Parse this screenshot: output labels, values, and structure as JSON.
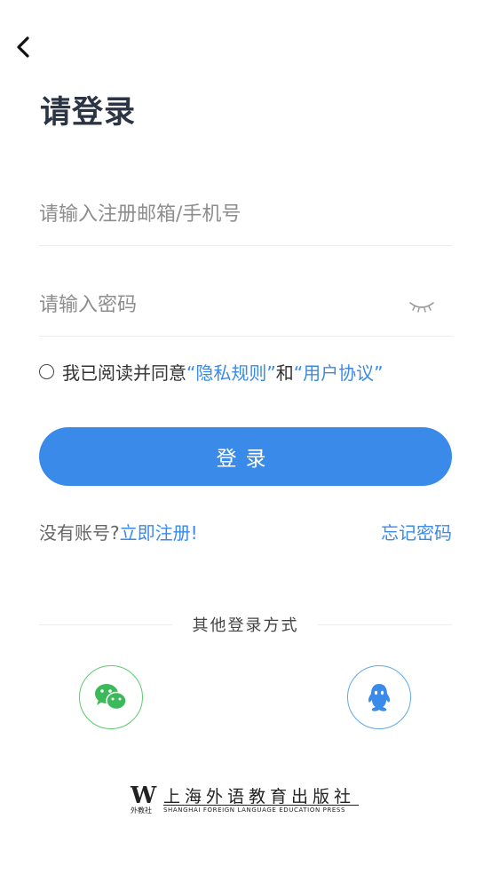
{
  "header": {
    "back_icon": "chevron-left-icon",
    "title": "请登录"
  },
  "form": {
    "account_placeholder": "请输入注册邮箱/手机号",
    "password_placeholder": "请输入密码",
    "password_visibility_icon": "eye-closed-icon"
  },
  "agreement": {
    "prefix": "我已阅读并同意",
    "privacy": "“隐私规则”",
    "and": "和",
    "user_agreement": "“用户协议”",
    "checked": false
  },
  "login_button": "登录",
  "register": {
    "prompt": "没有账号?",
    "link": "立即注册!"
  },
  "forgot_password": "忘记密码",
  "other_login": {
    "label": "其他登录方式",
    "methods": [
      {
        "name": "wechat",
        "icon": "wechat-icon",
        "color": "#3cb95a"
      },
      {
        "name": "qq",
        "icon": "qq-icon",
        "color": "#3a8aea"
      }
    ]
  },
  "publisher": {
    "logo_text": "W",
    "small": "外教社",
    "name_cn": "上海外语教育出版社",
    "name_en": "SHANGHAI FOREIGN LANGUAGE EDUCATION PRESS"
  },
  "colors": {
    "accent": "#3a8aea",
    "title": "#2b3445"
  }
}
